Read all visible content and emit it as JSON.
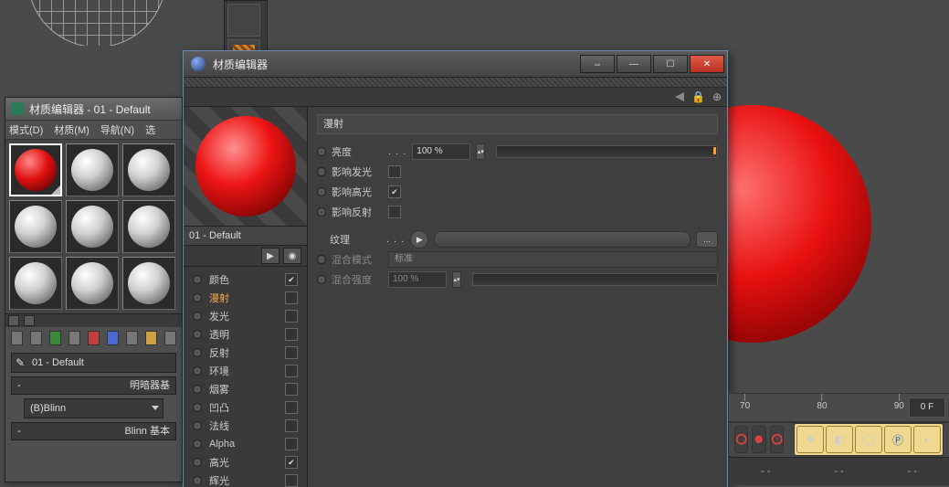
{
  "mwin": {
    "title": "材质编辑器 - 01 - Default",
    "menu": [
      "模式(D)",
      "材质(M)",
      "导航(N)",
      "选"
    ],
    "material_name": "01 - Default",
    "shader_section": "明暗器基",
    "shader_dropdown": "(B)Blinn",
    "params_section": "Blinn 基本"
  },
  "cwin": {
    "title": "材质编辑器",
    "material_name": "01 - Default",
    "channels": [
      {
        "label": "颜色",
        "checked": true
      },
      {
        "label": "漫射",
        "checked": false,
        "active": true
      },
      {
        "label": "发光",
        "checked": false
      },
      {
        "label": "透明",
        "checked": false
      },
      {
        "label": "反射",
        "checked": false
      },
      {
        "label": "环境",
        "checked": false
      },
      {
        "label": "烟雾",
        "checked": false
      },
      {
        "label": "凹凸",
        "checked": false
      },
      {
        "label": "法线",
        "checked": false
      },
      {
        "label": "Alpha",
        "checked": false
      },
      {
        "label": "高光",
        "checked": true
      },
      {
        "label": "辉光",
        "checked": false
      }
    ],
    "section": "漫射",
    "brightness_label": "亮度",
    "brightness_value": "100 %",
    "affect_luminance": "影响发光",
    "affect_specular": "影响高光",
    "affect_reflection": "影响反射",
    "texture_label": "纹理",
    "blend_mode_label": "混合模式",
    "blend_mode_value": "标准",
    "blend_strength_label": "混合强度",
    "blend_strength_value": "100 %",
    "ellipsis": ". . .",
    "more": "..."
  },
  "ruler": {
    "ticks": [
      {
        "v": "70",
        "p": 5
      },
      {
        "v": "80",
        "p": 40
      },
      {
        "v": "90",
        "p": 75
      }
    ],
    "temp": "0 F"
  },
  "status": {
    "a": "- -",
    "b": "- -",
    "c": "- -"
  }
}
